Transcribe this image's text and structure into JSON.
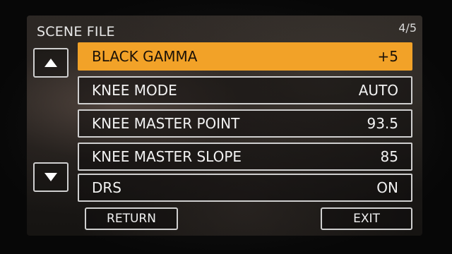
{
  "menu": {
    "title": "SCENE FILE",
    "page_indicator": "4/5"
  },
  "navigation": {
    "up_icon": "triangle-up-icon",
    "down_icon": "triangle-down-icon"
  },
  "items": [
    {
      "label": "BLACK GAMMA",
      "value": "+5",
      "selected": true
    },
    {
      "label": "KNEE MODE",
      "value": "AUTO",
      "selected": false
    },
    {
      "label": "KNEE MASTER POINT",
      "value": "93.5",
      "selected": false
    },
    {
      "label": "KNEE MASTER SLOPE",
      "value": "85",
      "selected": false
    },
    {
      "label": "DRS",
      "value": "ON",
      "selected": false
    }
  ],
  "buttons": {
    "return_label": "RETURN",
    "exit_label": "EXIT"
  },
  "colors": {
    "highlight": "#f2a228",
    "border": "#cfcfcf",
    "text": "#f2f2f2"
  }
}
